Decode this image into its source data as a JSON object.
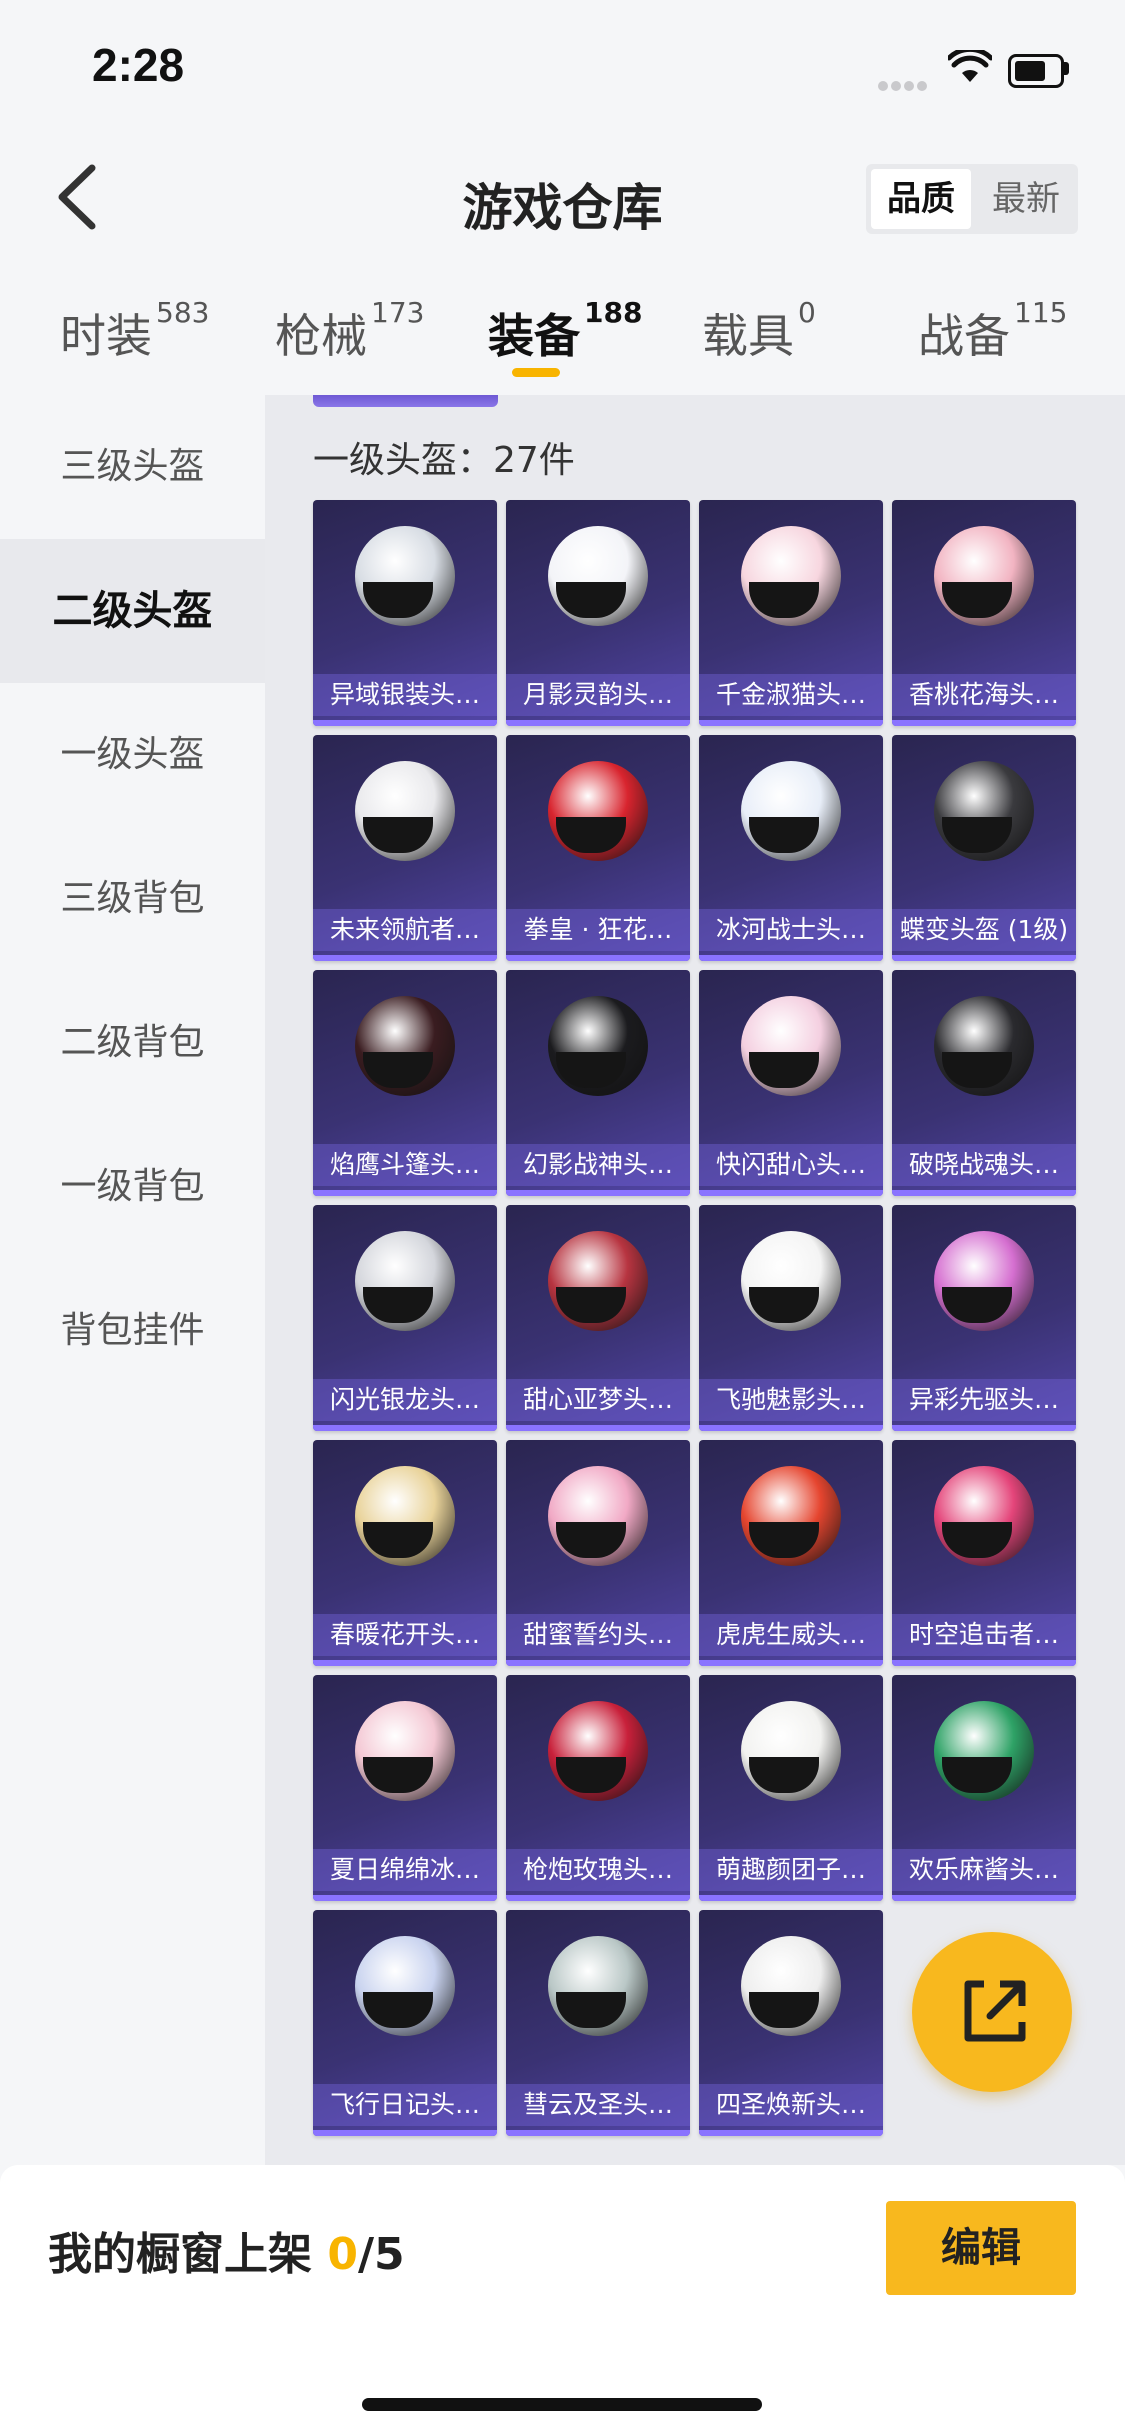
{
  "status": {
    "time": "2:28"
  },
  "header": {
    "title": "游戏仓库",
    "sort_quality": "品质",
    "sort_latest": "最新"
  },
  "tabs": [
    {
      "label": "时装",
      "count": "583"
    },
    {
      "label": "枪械",
      "count": "173"
    },
    {
      "label": "装备",
      "count": "188"
    },
    {
      "label": "载具",
      "count": "0"
    },
    {
      "label": "战备",
      "count": "115"
    }
  ],
  "sidebar": {
    "items": [
      {
        "label": "三级头盔"
      },
      {
        "label": "二级头盔"
      },
      {
        "label": "一级头盔"
      },
      {
        "label": "三级背包"
      },
      {
        "label": "二级背包"
      },
      {
        "label": "一级背包"
      },
      {
        "label": "背包挂件"
      }
    ]
  },
  "section": {
    "title": "一级头盔：27件"
  },
  "items": [
    {
      "name": "异域银装头…",
      "color": "#d8dde4"
    },
    {
      "name": "月影灵韵头…",
      "color": "#f3f4f8"
    },
    {
      "name": "千金淑猫头…",
      "color": "#f7d6df"
    },
    {
      "name": "香桃花海头…",
      "color": "#f2b4c2"
    },
    {
      "name": "未来领航者…",
      "color": "#e9e9ec"
    },
    {
      "name": "拳皇 · 狂花…",
      "color": "#d8242e"
    },
    {
      "name": "冰河战士头…",
      "color": "#e8eef8"
    },
    {
      "name": "蝶变头盔 (1级)",
      "color": "#3a3a3e"
    },
    {
      "name": "焰鹰斗篷头…",
      "color": "#3a1c20"
    },
    {
      "name": "幻影战神头…",
      "color": "#1b1b1e"
    },
    {
      "name": "快闪甜心头…",
      "color": "#f4cfe0"
    },
    {
      "name": "破晓战魂头…",
      "color": "#2a2a2e"
    },
    {
      "name": "闪光银龙头…",
      "color": "#d4d6dc"
    },
    {
      "name": "甜心亚梦头…",
      "color": "#b73440"
    },
    {
      "name": "飞驰魅影头…",
      "color": "#f4f4f4"
    },
    {
      "name": "异彩先驱头…",
      "color": "#d56fd0"
    },
    {
      "name": "春暖花开头…",
      "color": "#e9d39a"
    },
    {
      "name": "甜蜜誓约头…",
      "color": "#f1a9c5"
    },
    {
      "name": "虎虎生威头…",
      "color": "#e5452f"
    },
    {
      "name": "时空追击者…",
      "color": "#e4457a"
    },
    {
      "name": "夏日绵绵冰…",
      "color": "#f4c8d4"
    },
    {
      "name": "枪炮玫瑰头…",
      "color": "#c8203a"
    },
    {
      "name": "萌趣颜团子…",
      "color": "#f2f2f0"
    },
    {
      "name": "欢乐麻酱头…",
      "color": "#2ea266"
    },
    {
      "name": "飞行日记头…",
      "color": "#c9d3ef"
    },
    {
      "name": "彗云及圣头…",
      "color": "#b9c7c6"
    },
    {
      "name": "四圣焕新头…",
      "color": "#eeeeee"
    }
  ],
  "bottom": {
    "shelf_label": "我的橱窗上架 ",
    "shelf_current": "0",
    "shelf_total": "/5",
    "edit_label": "编辑"
  }
}
